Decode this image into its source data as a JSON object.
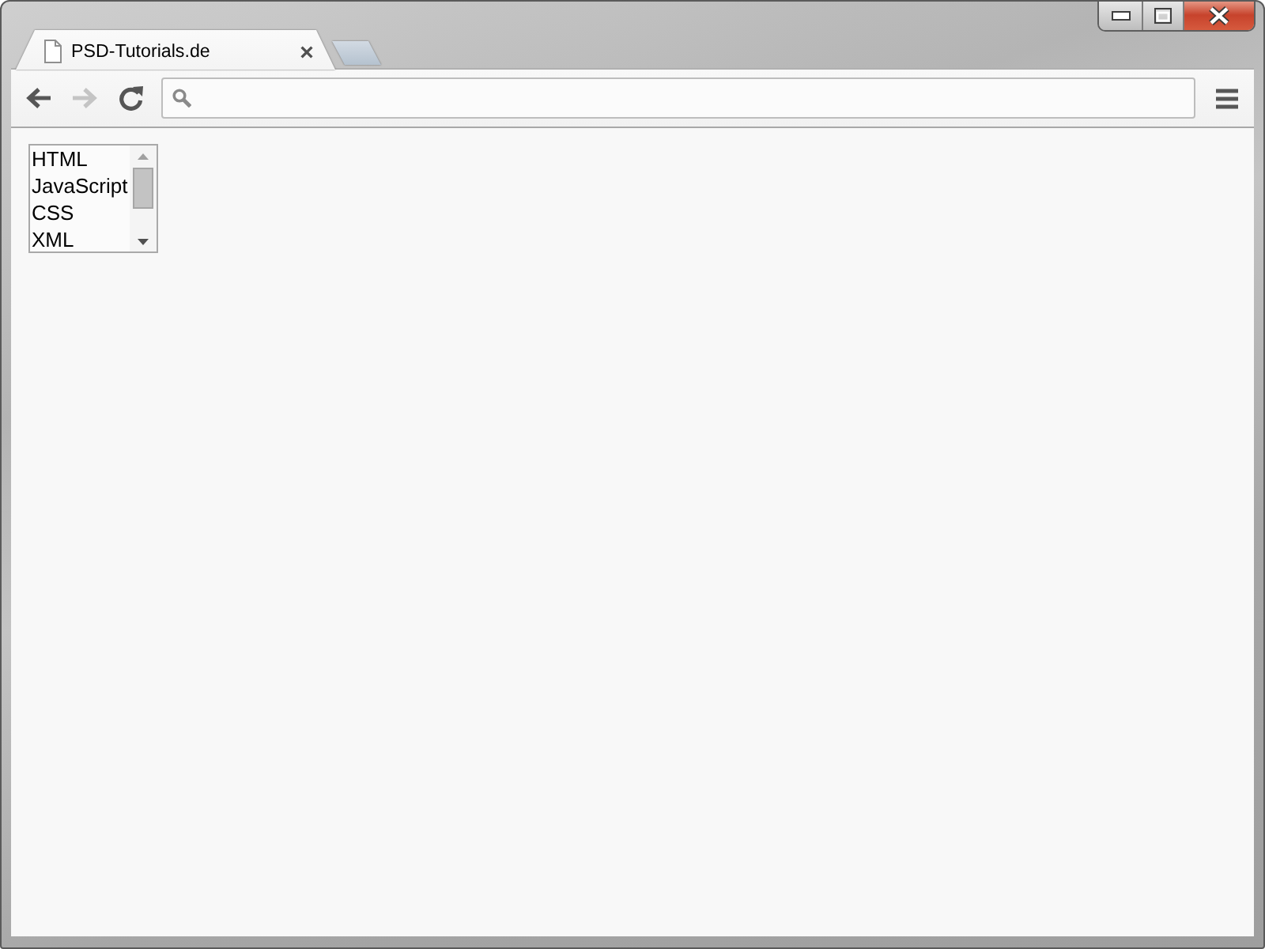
{
  "window_controls": [
    {
      "kind": "minimize"
    },
    {
      "kind": "maximize"
    },
    {
      "kind": "close"
    }
  ],
  "tabs": [
    {
      "title": "PSD-Tutorials.de",
      "selected": true
    }
  ],
  "toolbar": {
    "items": [
      {
        "kind": "back",
        "disabled": false
      },
      {
        "kind": "forward",
        "disabled": true
      },
      {
        "kind": "reload",
        "disabled": false
      },
      {
        "kind": "address_bar",
        "disabled": false
      },
      {
        "kind": "menu",
        "disabled": false
      }
    ]
  },
  "listbox": {
    "items": [
      {
        "label": "HTML",
        "selected": false
      },
      {
        "label": "JavaScript",
        "selected": false
      },
      {
        "label": "CSS",
        "selected": false
      },
      {
        "label": "XML",
        "selected": false
      }
    ]
  }
}
